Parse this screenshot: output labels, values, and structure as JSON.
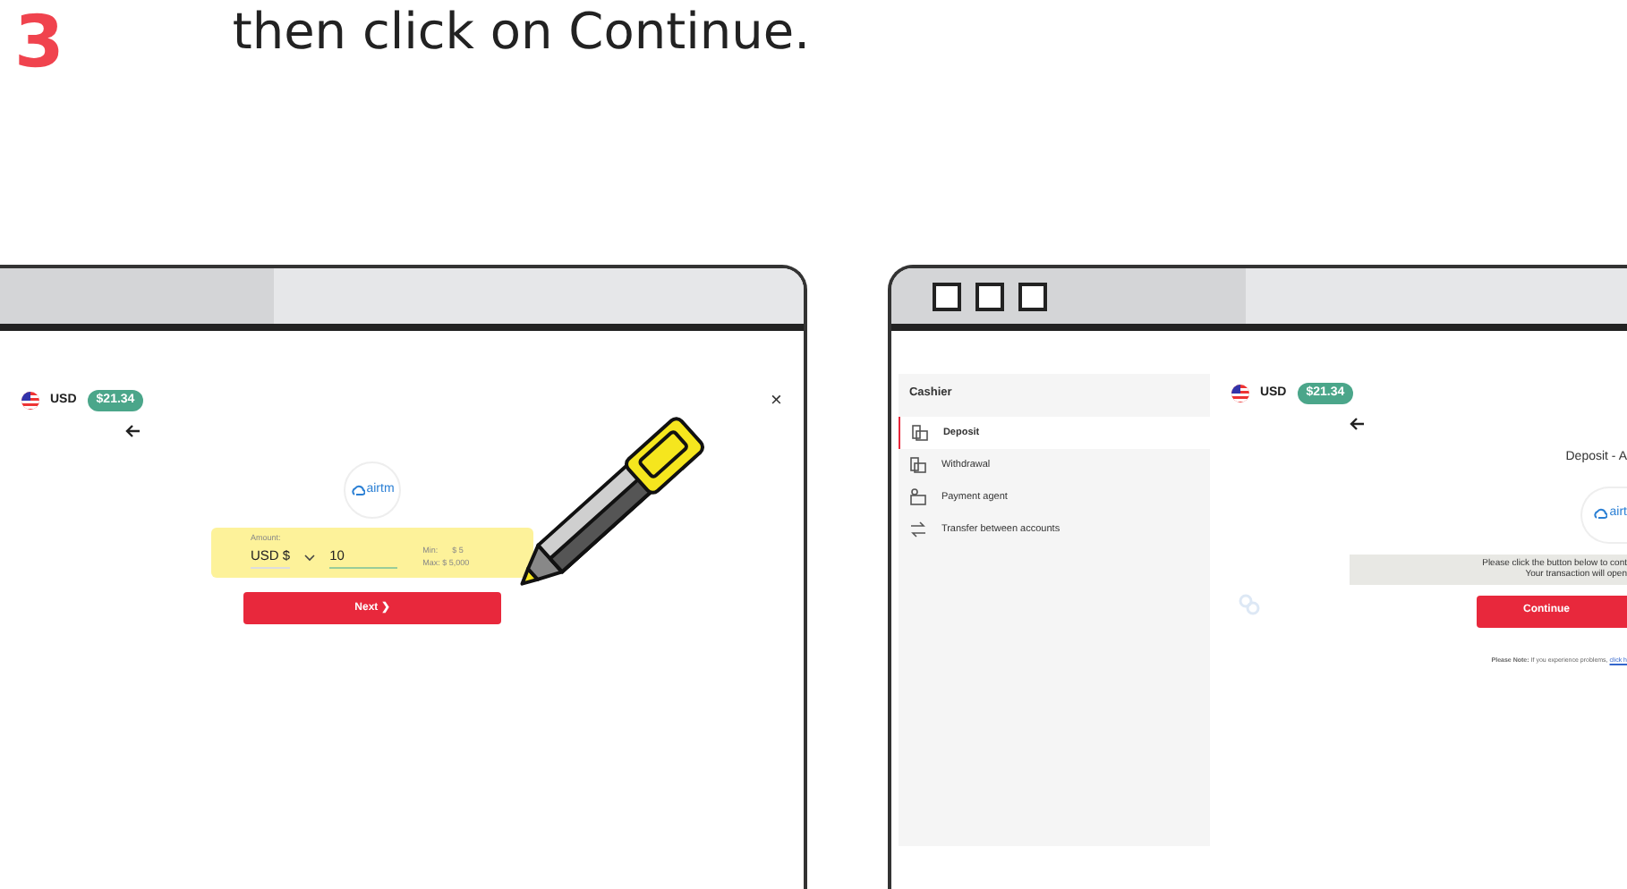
{
  "instruction": {
    "step": "3",
    "text": "then click on Continue."
  },
  "left_window": {
    "currency": "USD",
    "balance": "$21.34",
    "close": "×",
    "logo": "airtm",
    "amount_label": "Amount:",
    "currency_select": "USD $",
    "amount_value": "10",
    "min_label": "Min:",
    "min_value": "$ 5",
    "max_text": "Max: $ 5,000",
    "next_button": "Next ❯"
  },
  "right_window": {
    "sidebar": {
      "title": "Cashier",
      "items": [
        {
          "label": "Deposit",
          "kind": "card",
          "selected": true
        },
        {
          "label": "Withdrawal",
          "kind": "card",
          "selected": false
        },
        {
          "label": "Payment agent",
          "kind": "agent",
          "selected": false
        },
        {
          "label": "Transfer between accounts",
          "kind": "transfer",
          "selected": false
        }
      ]
    },
    "currency": "USD",
    "balance": "$21.34",
    "heading": "Deposit - A",
    "logo": "airt",
    "notice_lines": [
      "Please click the button below to cont",
      "Your transaction will open"
    ],
    "continue_button": "Continue",
    "note_bold": "Please Note:",
    "note_text": "If you experience problems,",
    "note_link": "click h"
  }
}
